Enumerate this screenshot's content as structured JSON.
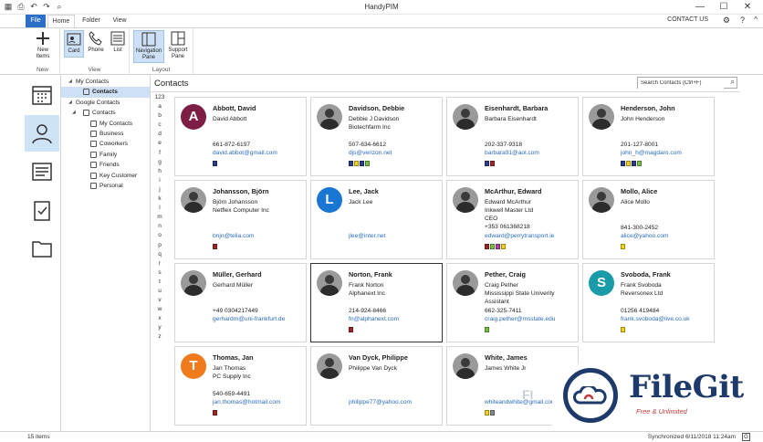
{
  "window": {
    "title": "HandyPIM"
  },
  "tabs": {
    "file": "File",
    "home": "Home",
    "folder": "Folder",
    "view": "View",
    "contact_us": "CONTACT US"
  },
  "ribbon": {
    "new_items": "New\nItems",
    "new_group": "New",
    "card": "Card",
    "phone": "Phone",
    "list": "List",
    "view_group": "View",
    "nav_pane": "Navigation\nPane",
    "support_pane": "Support\nPane",
    "layout_group": "Layout"
  },
  "tree": [
    {
      "label": "My Contacts",
      "level": 0,
      "expanded": true,
      "icon": false
    },
    {
      "label": "Contacts",
      "level": 1,
      "icon": true,
      "selected": true,
      "bold": true
    },
    {
      "label": "Google Contacts",
      "level": 0,
      "expanded": true,
      "icon": false
    },
    {
      "label": "Contacts",
      "level": 1,
      "expanded": true,
      "icon": true
    },
    {
      "label": "My Contacts",
      "level": 2,
      "icon": true
    },
    {
      "label": "Business",
      "level": 2,
      "icon": true
    },
    {
      "label": "Coworkers",
      "level": 2,
      "icon": true
    },
    {
      "label": "Family",
      "level": 2,
      "icon": true
    },
    {
      "label": "Friends",
      "level": 2,
      "icon": true
    },
    {
      "label": "Key Customer",
      "level": 2,
      "icon": true
    },
    {
      "label": "Personal",
      "level": 2,
      "icon": true
    }
  ],
  "main": {
    "title": "Contacts",
    "search_placeholder": "Search Contacts (Ctrl+F)"
  },
  "alphabet": [
    "123",
    "a",
    "b",
    "c",
    "d",
    "e",
    "f",
    "g",
    "h",
    "i",
    "j",
    "k",
    "l",
    "m",
    "n",
    "o",
    "p",
    "q",
    "r",
    "s",
    "t",
    "u",
    "v",
    "w",
    "x",
    "y",
    "z"
  ],
  "contacts": [
    {
      "name": "Abbott, David",
      "lines": [
        "David Abbott"
      ],
      "phone": "661-872-6197",
      "email": "david.abbot@gmail.com",
      "initial": "A",
      "avatar_color": "#7d1f45",
      "cats": [
        "#2c3e8c"
      ]
    },
    {
      "name": "Davidson, Debbie",
      "lines": [
        "Debbie J Davidson",
        "Biotechfarm Inc"
      ],
      "phone": "507-634-6612",
      "email": "djs@verizon.net",
      "photo": true,
      "cats": [
        "#2c3e8c",
        "#f2d21b",
        "#2c3e8c",
        "#76c043"
      ]
    },
    {
      "name": "Eisenhardt, Barbara",
      "lines": [
        "Barbara Eisenhardt"
      ],
      "phone": "202-337-9318",
      "email": "barbara91@aol.com",
      "photo": true,
      "cats": [
        "#2c3e8c",
        "#a02828"
      ]
    },
    {
      "name": "Henderson, John",
      "lines": [
        "John Henderson"
      ],
      "phone": "201-127-8001",
      "email": "john_h@magdaro.com",
      "photo": true,
      "cats": [
        "#2c3e8c",
        "#f2d21b",
        "#2c3e8c",
        "#76c043"
      ]
    },
    {
      "name": "Johansson, Björn",
      "lines": [
        "Björn Johansson",
        "Netflex Computer Inc"
      ],
      "phone": "",
      "email": "bnjn@telia.com",
      "photo": true,
      "cats": [
        "#a02828"
      ]
    },
    {
      "name": "Lee, Jack",
      "lines": [
        "Jack Lee"
      ],
      "phone": "",
      "email": "jlee@inter.net",
      "initial": "L",
      "avatar_color": "#1976d2",
      "cats": []
    },
    {
      "name": "McArthur, Edward",
      "lines": [
        "Edward McArthur",
        "Inkwell Master Ltd",
        "CEO",
        "+353 061368218"
      ],
      "phone": "",
      "email": "edward@perrytransport.ie",
      "photo": true,
      "cats": [
        "#a02828",
        "#76c043",
        "#b03fa0",
        "#f2d21b"
      ]
    },
    {
      "name": "Mollo, Alice",
      "lines": [
        "Alice Mollo"
      ],
      "phone": "841-300-2452",
      "email": "alice@yahoo.com",
      "photo": true,
      "cats": [
        "#f2d21b"
      ]
    },
    {
      "name": "Müller, Gerhard",
      "lines": [
        "Gerhard Müller"
      ],
      "phone": "+49 0304217449",
      "email": "gerhardm@uni-frankfurt.de",
      "photo": true,
      "cats": []
    },
    {
      "name": "Norton, Frank",
      "lines": [
        "Frank Norton",
        "Alphanext Inc"
      ],
      "phone": "214-924-8466",
      "email": "fn@alphanext.com",
      "photo": true,
      "focused": true,
      "cats": [
        "#a02828"
      ]
    },
    {
      "name": "Pether, Craig",
      "lines": [
        "Craig Pether",
        "Mississippi State Univerity",
        "Assistant"
      ],
      "phone": "662-325-7411",
      "email": "craig.pether@msstate.edu",
      "photo": true,
      "cats": [
        "#76c043"
      ]
    },
    {
      "name": "Svoboda, Frank",
      "lines": [
        "Frank Svoboda",
        "Reversonex Ltd"
      ],
      "phone": "01256 419484",
      "email": "frank.svoboda@live.co.uk",
      "initial": "S",
      "avatar_color": "#1a9ba8",
      "cats": [
        "#f2d21b"
      ]
    },
    {
      "name": "Thomas, Jan",
      "lines": [
        "Jan Thomas",
        "PC Supply Inc"
      ],
      "phone": "540-659-4491",
      "email": "jan.thomas@hotmail.com",
      "initial": "T",
      "avatar_color": "#f07b1c",
      "cats": [
        "#a02828"
      ]
    },
    {
      "name": "Van Dyck, Philippe",
      "lines": [
        "Philippe Van Dyck"
      ],
      "phone": "",
      "email": "philippe77@yahoo.com",
      "photo": true,
      "cats": []
    },
    {
      "name": "White, James",
      "lines": [
        "James White Jr"
      ],
      "phone": "",
      "email": "whiteandwhite@gmail.com",
      "photo": true,
      "cats": [
        "#f2d21b",
        "#888888"
      ]
    }
  ],
  "status": {
    "items": "15 items",
    "synced": "Synchronized 6/11/2018 11:24am"
  },
  "watermark": {
    "title": "FileGit",
    "subtitle": "Free & Unlimited",
    "fade": "FI"
  }
}
